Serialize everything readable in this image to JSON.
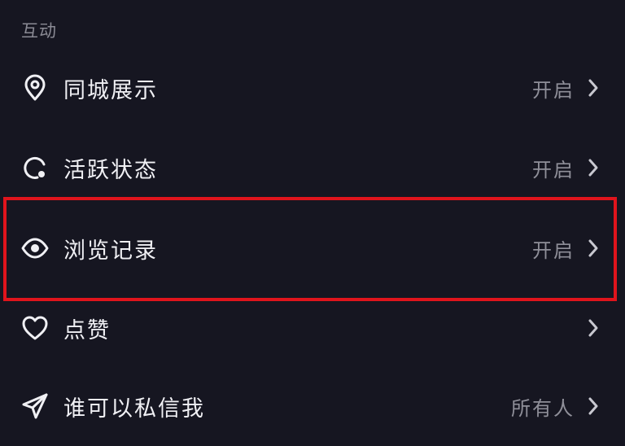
{
  "section": {
    "title": "互动"
  },
  "items": [
    {
      "icon": "location-pin-icon",
      "label": "同城展示",
      "value": "开启"
    },
    {
      "icon": "activity-status-icon",
      "label": "活跃状态",
      "value": "开启"
    },
    {
      "icon": "eye-icon",
      "label": "浏览记录",
      "value": "开启"
    },
    {
      "icon": "heart-icon",
      "label": "点赞",
      "value": ""
    },
    {
      "icon": "paper-plane-icon",
      "label": "谁可以私信我",
      "value": "所有人"
    }
  ],
  "colors": {
    "background": "#161621",
    "highlight": "#e0141c",
    "label": "#f0f0f4",
    "value": "#8f8f99"
  }
}
